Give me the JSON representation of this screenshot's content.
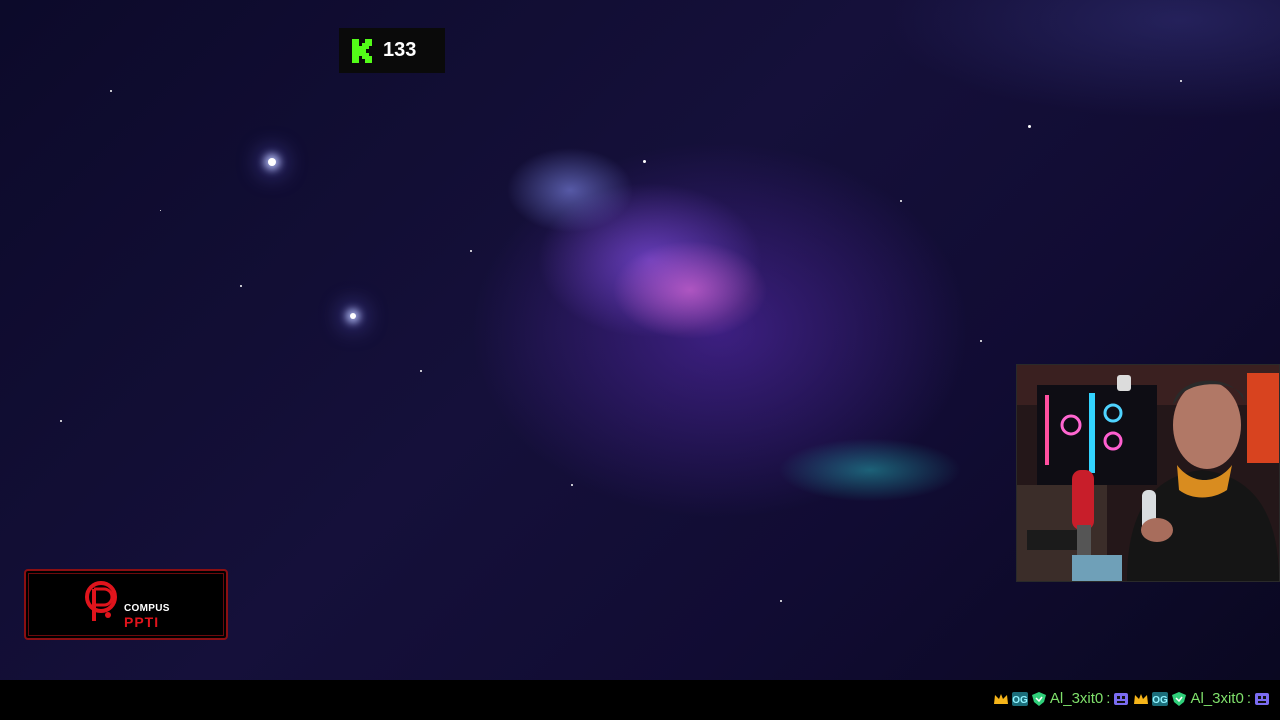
{
  "kick": {
    "logo_icon": "kick-logo-icon",
    "viewer_count": "133",
    "brand_color": "#53fc18"
  },
  "sponsor": {
    "line1": "COMPUS",
    "line2": "PPTI",
    "brand_color": "#e0141c"
  },
  "webcam": {
    "description_icon": "webcam-feed"
  },
  "chat": {
    "messages": [
      {
        "user": "Al_3xit0",
        "separator": ":"
      },
      {
        "user": "Al_3xit0",
        "separator": ":"
      }
    ],
    "badges": [
      "crown-badge-icon",
      "og-badge-icon",
      "shield-badge-icon",
      "emote-icon"
    ],
    "username_color": "#7fe06b"
  }
}
